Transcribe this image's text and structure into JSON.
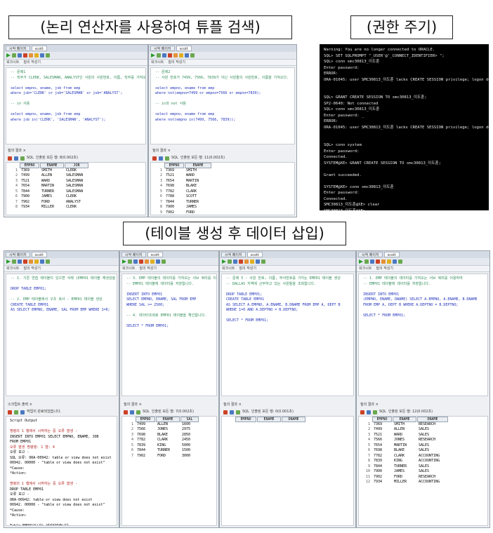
{
  "captions": {
    "logic": "(논리 연산자를 사용하여 튜플 검색)",
    "grant": "(권한 주기)",
    "create": "(테이블 생성 후 데이터 삽입)"
  },
  "ui": {
    "tab_start": "시작 페이지",
    "tab_conn": "scott",
    "tab_work": "워크시트",
    "tab_builder": "질의 작성기",
    "tab_result": "질의 결과",
    "tab_script": "스크립트 출력",
    "tab_x": "×",
    "sql_label": "SQL",
    "fetch_label": "인출된 모든 행:",
    "fetch_label_short": "작업이 완료되었습니다.",
    "conn_select": "scott"
  },
  "p1": {
    "editor": [
      {
        "t": "-- 문제1",
        "c": "cm"
      },
      {
        "t": "-- 직무가 CLERK, SALESMAN, ANALYST인 사원의 사원번호, 이름, 직무를 가져오다.",
        "c": "cm"
      },
      {
        "t": "",
        "c": ""
      },
      {
        "t": "select empno, ename, job from emp",
        "c": "kw"
      },
      {
        "t": "where job='CLERK' or job='SALESMAN' or job='ANALYST';",
        "c": "kw"
      },
      {
        "t": "",
        "c": ""
      },
      {
        "t": "-- in 사용",
        "c": "cm"
      },
      {
        "t": "",
        "c": ""
      },
      {
        "t": "select empno, ename, job from emp",
        "c": "kw"
      },
      {
        "t": "where job in('CLERK', 'SALESMAN', 'ANALYST');",
        "c": "kw"
      }
    ],
    "fetch": "인출된 모든 행: 8(0.002초)",
    "cols": [
      "EMPNO",
      "ENAME",
      "JOB"
    ],
    "rows": [
      [
        "1",
        "7369",
        "SMITH",
        "CLERK"
      ],
      [
        "2",
        "7499",
        "ALLEN",
        "SALESMAN"
      ],
      [
        "3",
        "7521",
        "WARD",
        "SALESMAN"
      ],
      [
        "4",
        "7654",
        "MARTIN",
        "SALESMAN"
      ],
      [
        "5",
        "7844",
        "TURNER",
        "SALESMAN"
      ],
      [
        "6",
        "7900",
        "JAMES",
        "CLERK"
      ],
      [
        "7",
        "7902",
        "FORD",
        "ANALYST"
      ],
      [
        "8",
        "7934",
        "MILLER",
        "CLERK"
      ]
    ]
  },
  "p2": {
    "editor": [
      {
        "t": "-- 문제2",
        "c": "cm"
      },
      {
        "t": "-- 사원 번호가 7499, 7566, 7839가 아닌 사원들의 사원번호, 이름을 가져오다.",
        "c": "cm"
      },
      {
        "t": "",
        "c": ""
      },
      {
        "t": "select empno, ename from emp",
        "c": "kw"
      },
      {
        "t": "where not(empno=7499 or empno=7566 or empno=7839);",
        "c": "kw"
      },
      {
        "t": "",
        "c": ""
      },
      {
        "t": "-- in과 not 사용",
        "c": "cm"
      },
      {
        "t": "",
        "c": ""
      },
      {
        "t": "select empno, ename from emp",
        "c": "kw"
      },
      {
        "t": "where not(empno in(7499, 7566, 7839));",
        "c": "kw"
      }
    ],
    "fetch": "인출된 모든 행: 11(0.002초)",
    "cols": [
      "EMPNO",
      "ENAME"
    ],
    "rows": [
      [
        "1",
        "7369",
        "SMITH"
      ],
      [
        "2",
        "7521",
        "WARD"
      ],
      [
        "3",
        "7654",
        "MARTIN"
      ],
      [
        "4",
        "7698",
        "BLAKE"
      ],
      [
        "5",
        "7782",
        "CLARK"
      ],
      [
        "6",
        "7788",
        "SCOTT"
      ],
      [
        "7",
        "7844",
        "TURNER"
      ],
      [
        "8",
        "7900",
        "JAMES"
      ],
      [
        "9",
        "7902",
        "FORD"
      ]
    ]
  },
  "terminal": [
    "Warning: You are no longer connected to ORACLE.",
    "SQL> SET SQLPROMPT \"_USER'@'_CONNECT_IDENTIFIER> \";",
    "SQL> conn smc30813_이도훈",
    "Enter password:",
    "ERROR:",
    "ORA-01045: user SMC30813_이도훈 lacks CREATE SESSION privilege; logon denied",
    "",
    "",
    "SQL> GRANT CREATE SESSION TO smc30813_이도훈;",
    "SP2-0640: Not connected",
    "SQL> conn smc30813_이도훈",
    "Enter password: _",
    "ERROR:",
    "ORA-01045: user SMC30813_이도훈 lacks CREATE SESSION privilege; logon denied",
    "",
    "",
    "SQL> conn system",
    "Enter password:",
    "Connected.",
    "SYSTEM@XE> GRANT CREATE SESSION TO smc30813_이도훈;",
    "",
    "Grant succeeded.",
    "",
    "SYSTEM@XE> conn smc30813_이도훈",
    "Enter password:",
    "Connected.",
    "SMC30813_이도훈@XE> clear",
    "SMC30813_이도훈@XE>"
  ],
  "b1": {
    "editor": [
      {
        "t": "-- 1. 기존 연습 테이블이 있으면 삭제 (EMP01 테이블 재생성을 위해)",
        "c": "cm"
      },
      {
        "t": "",
        "c": ""
      },
      {
        "t": "DROP TABLE EMP01;",
        "c": "kw"
      },
      {
        "t": "",
        "c": ""
      },
      {
        "t": "-- 2. EMP 테이블에서 구조 복사 - EMP01 테이블 생성",
        "c": "cm"
      },
      {
        "t": "CREATE TABLE EMP01",
        "c": "kw"
      },
      {
        "t": "AS SELECT EMPNO, ENAME, SAL FROM EMP WHERE 1=0;",
        "c": "kw"
      }
    ],
    "script": [
      {
        "t": "Script Output",
        "c": ""
      },
      {
        "t": "",
        "c": ""
      },
      {
        "t": "명령의 1 행에서 시작하는 중 오류 발생 -",
        "c": "err"
      },
      {
        "t": "INSERT INTO EMP01 SELECT EMPNO, ENAME, JOB",
        "c": ""
      },
      {
        "t": "FROM EMP01",
        "c": ""
      },
      {
        "t": "오류 발생 명령행: 1 열: 4",
        "c": "err"
      },
      {
        "t": "오류 보고 -",
        "c": ""
      },
      {
        "t": "SQL 오류: ORA-00942: table or view does not exist",
        "c": ""
      },
      {
        "t": "00942. 00000 - \"table or view does not exist\"",
        "c": ""
      },
      {
        "t": "*Cause:",
        "c": ""
      },
      {
        "t": "*Action:",
        "c": ""
      },
      {
        "t": "",
        "c": ""
      },
      {
        "t": "명령의 1 행에서 시작하는 중 오류 발생 -",
        "c": "err"
      },
      {
        "t": "DROP TABLE EMP01",
        "c": ""
      },
      {
        "t": "오류 보고 -",
        "c": ""
      },
      {
        "t": "ORA-00942: table or view does not exist",
        "c": ""
      },
      {
        "t": "00942. 00000 - \"table or view does not exist\"",
        "c": ""
      },
      {
        "t": "*Cause:",
        "c": ""
      },
      {
        "t": "*Action:",
        "c": ""
      },
      {
        "t": "",
        "c": ""
      },
      {
        "t": "Table EMP01이(가) 생성되었습니다.",
        "c": ""
      }
    ]
  },
  "b2": {
    "editor": [
      {
        "t": "-- 3. EMP 테이블의 데이터를 가져오는 서브 쿼리를 이용하여",
        "c": "cm"
      },
      {
        "t": "-- EMP01 테이블에 데이터를 저장합니다.",
        "c": "cm"
      },
      {
        "t": "",
        "c": ""
      },
      {
        "t": "INSERT INTO EMP01",
        "c": "kw"
      },
      {
        "t": "SELECT EMPNO, ENAME, SAL FROM EMP",
        "c": "kw"
      },
      {
        "t": "WHERE SAL >= 2500;",
        "c": "kw"
      },
      {
        "t": "",
        "c": ""
      },
      {
        "t": "-- 4. 데이터조회로 EMP01 테이블을 확인합니다.",
        "c": "cm"
      },
      {
        "t": "",
        "c": ""
      },
      {
        "t": "SELECT * FROM EMP01;",
        "c": "kw"
      }
    ],
    "fetch": "인출된 모든 행: 7(0.002초)",
    "cols": [
      "EMPNO",
      "ENAME",
      "SAL"
    ],
    "rows": [
      [
        "1",
        "7499",
        "ALLEN",
        "1600"
      ],
      [
        "2",
        "7566",
        "JONES",
        "2975"
      ],
      [
        "3",
        "7698",
        "BLAKE",
        "2850"
      ],
      [
        "4",
        "7782",
        "CLARK",
        "2450"
      ],
      [
        "5",
        "7839",
        "KING",
        "5000"
      ],
      [
        "6",
        "7844",
        "TURNER",
        "1500"
      ],
      [
        "7",
        "7902",
        "FORD",
        "3000"
      ]
    ]
  },
  "b3": {
    "editor": [
      {
        "t": "-- 문제 5 - 사원 번호, 이름, 부서번호를 가지는 EMP01 테이블 생성",
        "c": "cm"
      },
      {
        "t": "-- DALLAS 지역에 근무하고 있는 사원들을 조회합니다.",
        "c": "cm"
      },
      {
        "t": "",
        "c": ""
      },
      {
        "t": "DROP TABLE EMP01;",
        "c": "kw"
      },
      {
        "t": "CREATE TABLE EMP01",
        "c": "kw"
      },
      {
        "t": "AS SELECT A.EMPNO, A.ENAME, B.DNAME FROM EMP A, DEPT B",
        "c": "kw"
      },
      {
        "t": "WHERE 1=0 AND A.DEPTNO = B.DEPTNO;",
        "c": "kw"
      },
      {
        "t": "",
        "c": ""
      },
      {
        "t": "SELECT * FROM EMP01;",
        "c": "kw"
      }
    ],
    "fetch": "인출된 모든 행: 0(0.001초)",
    "cols": [
      "EMPNO",
      "ENAME",
      "DNAME"
    ],
    "rows": []
  },
  "b4": {
    "editor": [
      {
        "t": "-- 1. EMP 테이블의 데이터를 가져오는 서브 쿼리를 이용하여",
        "c": "cm"
      },
      {
        "t": "-- EMP01 테이블에 데이터를 저장합니다.",
        "c": "cm"
      },
      {
        "t": "",
        "c": ""
      },
      {
        "t": "INSERT INTO EMP01",
        "c": "kw"
      },
      {
        "t": "(EMPNO, ENAME, DNAME) SELECT A.EMPNO, A.ENAME, B.DNAME",
        "c": "kw"
      },
      {
        "t": "FROM EMP A, DEPT B WHERE A.DEPTNO = B.DEPTNO;",
        "c": "kw"
      },
      {
        "t": "",
        "c": ""
      },
      {
        "t": "SELECT * FROM EMP01;",
        "c": "kw"
      }
    ],
    "fetch": "인출된 모든 행: 12(0.002초)",
    "cols": [
      "EMPNO",
      "ENAME",
      "DNAME"
    ],
    "rows": [
      [
        "1",
        "7369",
        "SMITH",
        "RESEARCH"
      ],
      [
        "2",
        "7499",
        "ALLEN",
        "SALES"
      ],
      [
        "3",
        "7521",
        "WARD",
        "SALES"
      ],
      [
        "4",
        "7566",
        "JONES",
        "RESEARCH"
      ],
      [
        "5",
        "7654",
        "MARTIN",
        "SALES"
      ],
      [
        "6",
        "7698",
        "BLAKE",
        "SALES"
      ],
      [
        "7",
        "7782",
        "CLARK",
        "ACCOUNTING"
      ],
      [
        "8",
        "7839",
        "KING",
        "ACCOUNTING"
      ],
      [
        "9",
        "7844",
        "TURNER",
        "SALES"
      ],
      [
        "10",
        "7900",
        "JAMES",
        "SALES"
      ],
      [
        "11",
        "7902",
        "FORD",
        "RESEARCH"
      ],
      [
        "12",
        "7934",
        "MILLER",
        "ACCOUNTING"
      ]
    ]
  }
}
